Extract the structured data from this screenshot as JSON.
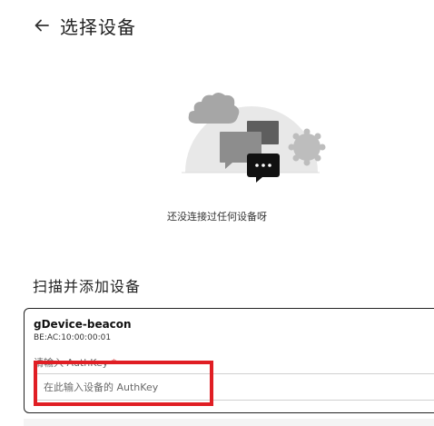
{
  "header": {
    "title": "选择设备",
    "back_icon": "arrow-left-icon"
  },
  "empty_state": {
    "message": "还没连接过任何设备呀",
    "illustration_icon": "chat-bubbles-illustration"
  },
  "section": {
    "title": "扫描并添加设备"
  },
  "device": {
    "name": "gDevice-beacon",
    "mac": "BE:AC:10:00:00:01",
    "auth_label": "请输入 AuthKey",
    "auth_required_mark": "*",
    "auth_value": "",
    "auth_placeholder": "在此输入设备的 AuthKey"
  },
  "colors": {
    "highlight": "#e01e24",
    "card_border": "#222222"
  }
}
